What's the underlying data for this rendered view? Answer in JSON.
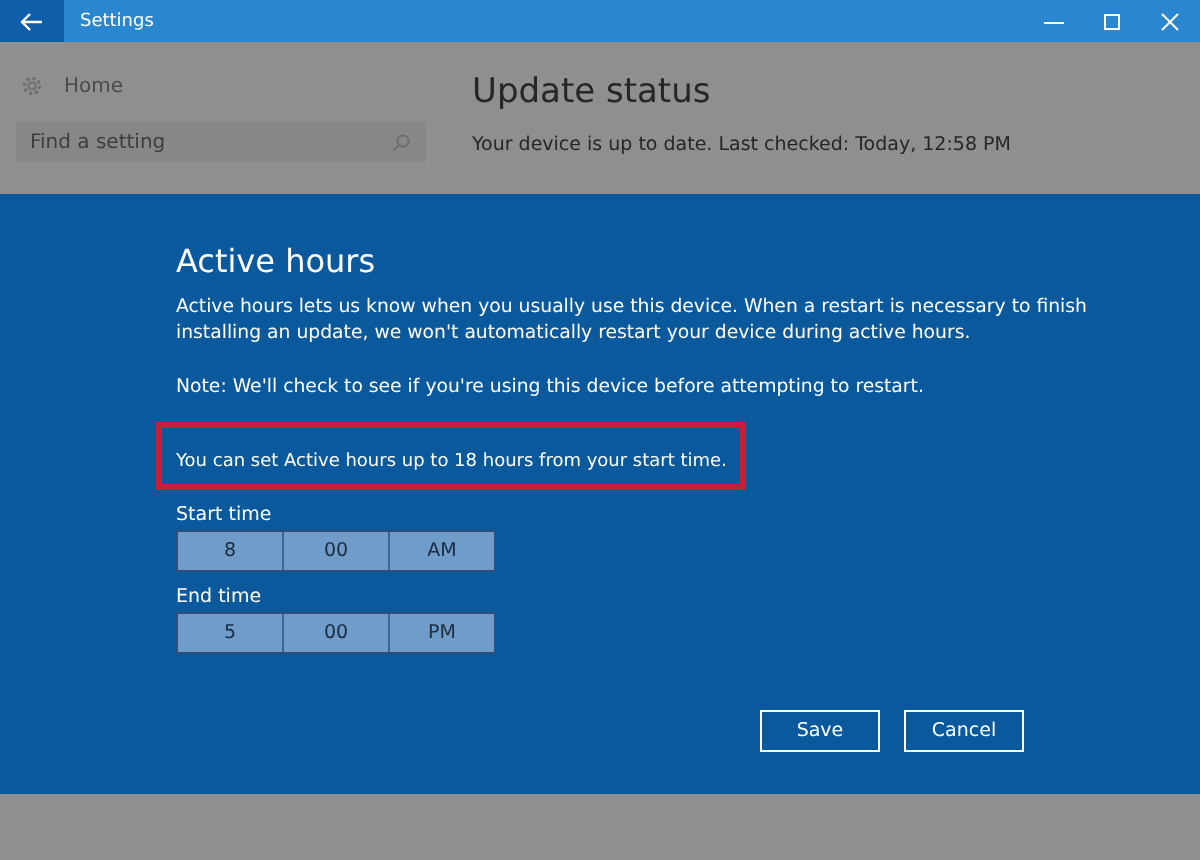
{
  "window": {
    "title": "Settings"
  },
  "sidebar": {
    "home": "Home",
    "search": {
      "placeholder": "Find a setting"
    }
  },
  "main": {
    "heading": "Update status",
    "status": "Your device is up to date. Last checked: Today, 12:58 PM"
  },
  "dialog": {
    "title": "Active hours",
    "description": "Active hours lets us know when you usually use this device. When a restart is necessary to finish installing an update, we won't automatically restart your device during active hours.",
    "note": "Note: We'll check to see if you're using this device before attempting to restart.",
    "highlight": "You can set Active hours up to 18 hours from your start time.",
    "pickers": [
      {
        "label": "Start time",
        "hour": "8",
        "minute": "00",
        "period": "AM"
      },
      {
        "label": "End time",
        "hour": "5",
        "minute": "00",
        "period": "PM"
      }
    ],
    "buttons": [
      "Save",
      "Cancel"
    ]
  }
}
